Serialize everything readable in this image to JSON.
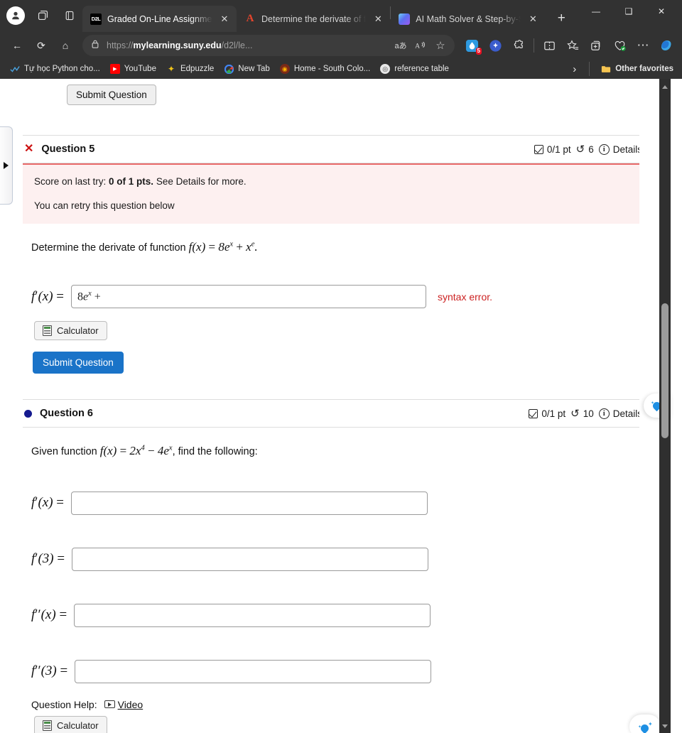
{
  "browser": {
    "window_controls": {
      "minimize": "—",
      "maximize": "❑",
      "close": "✕"
    },
    "new_tab_label": "+",
    "tabs": [
      {
        "title": "Graded On-Line Assignment",
        "favicon": "d2l-icon",
        "favicon_text": "D2L",
        "active": true,
        "close_label": "✕"
      },
      {
        "title": "Determine the derivate of f",
        "favicon": "adobe-acrobat-icon",
        "favicon_text": "A",
        "active": false,
        "close_label": "✕"
      },
      {
        "title": "AI Math Solver & Step-by-S",
        "favicon": "ai-solver-icon",
        "favicon_text": "",
        "active": false,
        "close_label": "✕"
      }
    ],
    "nav": {
      "back": "←",
      "refresh": "⟳",
      "home": "⌂"
    },
    "omnibox": {
      "lock_icon": "lock-icon",
      "url_scheme": "https://",
      "url_domain": "mylearning.suny.edu",
      "url_path": "/d2l/le...",
      "translate_label": "aあ",
      "read_aloud_label": "A",
      "favorite_label": "☆"
    },
    "extensions": [
      {
        "name": "blue-drop-extension",
        "badge": "5"
      },
      {
        "name": "copilot-sparkle-extension",
        "badge": ""
      },
      {
        "name": "puzzle-extensions-icon",
        "badge": ""
      },
      {
        "name": "split-screen-icon",
        "badge": ""
      },
      {
        "name": "favorites-star-icon",
        "badge": ""
      },
      {
        "name": "collections-icon",
        "badge": ""
      },
      {
        "name": "browser-essentials-icon",
        "badge": ""
      },
      {
        "name": "settings-more-icon",
        "badge": "⋯"
      },
      {
        "name": "copilot-icon",
        "badge": ""
      }
    ],
    "bookmarks": [
      {
        "label": "Tự học Python cho...",
        "icon": "python-course-icon",
        "glyph": "✓"
      },
      {
        "label": "YouTube",
        "icon": "youtube-icon",
        "glyph": "▶"
      },
      {
        "label": "Edpuzzle",
        "icon": "edpuzzle-icon",
        "glyph": "✿"
      },
      {
        "label": "New Tab",
        "icon": "google-icon",
        "glyph": "G"
      },
      {
        "label": "Home - South Colo...",
        "icon": "school-mascot-icon",
        "glyph": "◉"
      },
      {
        "label": "reference table",
        "icon": "reference-table-icon",
        "glyph": "○"
      }
    ],
    "bookmarks_overflow_label": "›",
    "other_favorites": {
      "label": "Other favorites",
      "icon": "folder-icon",
      "glyph": "▰"
    }
  },
  "page": {
    "drawer_toggle": {
      "name": "left-drawer-expand",
      "glyph": "▶"
    },
    "top_submit_button": "Submit Question",
    "questions": [
      {
        "id": "question-5",
        "title": "Question 5",
        "status_icon": "incorrect-x-icon",
        "status_glyph": "✕",
        "points": "0/1 pt",
        "attempts": "6",
        "details_label": "Details",
        "banner": {
          "line1_prefix": "Score on last try: ",
          "line1_bold": "0 of 1 pts.",
          "line1_suffix": " See Details for more.",
          "line2": "You can retry this question below"
        },
        "prompt_text": "Determine the derivate of function",
        "prompt_math": "f(x) = 8eˣ + xᵉ.",
        "answer_label": "f′(x) =",
        "answer_value": "8eˣ +",
        "error_text": "syntax error.",
        "calculator_label": "Calculator",
        "submit_label": "Submit Question"
      },
      {
        "id": "question-6",
        "title": "Question 6",
        "status_icon": "unanswered-dot-icon",
        "status_glyph": "●",
        "points": "0/1 pt",
        "attempts": "10",
        "details_label": "Details",
        "prompt_text_prefix": "Given function",
        "prompt_math": "f(x) = 2x⁴ − 4eˣ,",
        "prompt_text_suffix": "find the following:",
        "answers": [
          {
            "label": "f′(x) =",
            "value": ""
          },
          {
            "label": "f′(3) =",
            "value": ""
          },
          {
            "label": "f′′(x) =",
            "value": ""
          },
          {
            "label": "f′′(3) =",
            "value": ""
          }
        ],
        "help_label": "Question Help:",
        "help_video_label": "Video",
        "calculator_label": "Calculator"
      }
    ],
    "colors": {
      "accent_blue": "#1a73c8",
      "error_red": "#cc2222",
      "banner_bg": "#fdf0f0",
      "banner_border": "#e96a6a",
      "dot_navy": "#151a8f"
    }
  }
}
